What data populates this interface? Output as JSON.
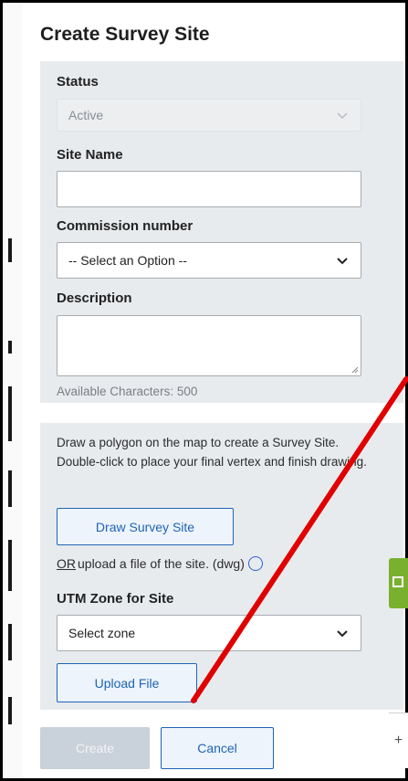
{
  "dialog": {
    "title": "Create Survey Site"
  },
  "form": {
    "status": {
      "label": "Status",
      "value": "Active"
    },
    "site_name": {
      "label": "Site Name",
      "value": ""
    },
    "commission": {
      "label": "Commission number",
      "value": "-- Select an Option --"
    },
    "description": {
      "label": "Description",
      "value": "",
      "helper": "Available Characters: 500"
    }
  },
  "draw": {
    "instructions": "Draw a polygon on the map to create a Survey Site. Double-click to place your final vertex and finish drawing.",
    "button": "Draw Survey Site",
    "or_text": "OR",
    "upload_text": " upload a file of the site. (dwg)",
    "utm_label": "UTM Zone for Site",
    "utm_value": "Select zone",
    "upload_button": "Upload File"
  },
  "footer": {
    "create": "Create",
    "cancel": "Cancel"
  },
  "map": {
    "plus": "+"
  },
  "colors": {
    "accent": "#1f64b5",
    "panel": "#e8ebee",
    "annotation": "#e00000",
    "green_tab": "#79b12f"
  },
  "icons": [
    "chevron-down-icon",
    "info-icon",
    "plus-icon",
    "widget-icon"
  ]
}
